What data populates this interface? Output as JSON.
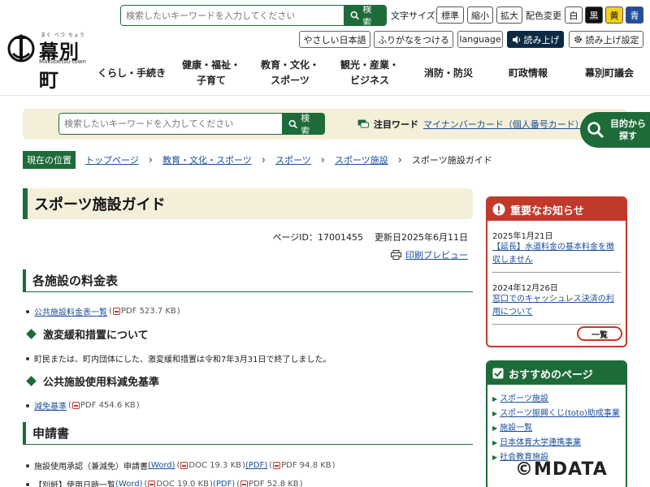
{
  "header": {
    "logo": {
      "kana": "まく べつ ちょう",
      "name": "幕別町",
      "roman": "Makubetsu-town"
    },
    "search": {
      "placeholder": "検索したいキーワードを入力してください",
      "button": "検索"
    },
    "font_size": {
      "label": "文字サイズ",
      "options": [
        "標準",
        "縮小",
        "拡大"
      ]
    },
    "color_change": {
      "label": "配色変更",
      "options": [
        "白",
        "黒",
        "黄",
        "青"
      ]
    },
    "tools": {
      "easy_japanese": "やさしい日本語",
      "furigana": "ふりがなをつける",
      "language": "language",
      "read_aloud": "読み上げ",
      "read_settings": "読み上げ設定"
    },
    "nav": [
      "くらし・手続き",
      "健康・福祉・\n子育て",
      "教育・文化・\nスポーツ",
      "観光・産業・\nビジネス",
      "消防・防災",
      "町政情報",
      "幕別町議会"
    ]
  },
  "searchbar": {
    "placeholder": "検索したいキーワードを入力してください",
    "button": "検索",
    "hot_label": "注目ワード",
    "hot_link": "マイナンバーカード（個人番号カード）",
    "purpose_button": "目的から\n探す"
  },
  "breadcrumb": {
    "here": "現在の位置",
    "links": [
      "トップページ",
      "教育・文化・スポーツ",
      "スポーツ",
      "スポーツ施設"
    ],
    "current": "スポーツ施設ガイド"
  },
  "page": {
    "title": "スポーツ施設ガイド",
    "page_id": "ページID：17001455",
    "updated": "更新日2025年6月11日",
    "print": "印刷プレビュー"
  },
  "sections": {
    "fees": {
      "heading": "各施設の料金表",
      "link": "公共施設料金表一覧",
      "file": "PDF 523.7 KB"
    },
    "relief": {
      "heading": "激変緩和措置について",
      "text": "町民または、町内団体にした、激変緩和措置は令和7年3月31日で終了しました。"
    },
    "reduction": {
      "heading": "公共施設使用料減免基準",
      "link": "減免基準",
      "file": "PDF 454.6 KB"
    },
    "application": {
      "heading": "申請書",
      "item1": {
        "text": "施設使用承認（兼減免）申請書",
        "word": "(Word)",
        "word_file": "DOC 19.3 KB",
        "pdf": "(PDF)",
        "pdf_file": "PDF 94.8 KB"
      },
      "item2": {
        "text": "【別紙】使用日時一覧",
        "word": "(Word)",
        "word_file": "DOC 19.0 KB",
        "pdf": "(PDF)",
        "pdf_file": "PDF 52.8 KB"
      }
    }
  },
  "sidebar": {
    "notice": {
      "heading": "重要なお知らせ",
      "items": [
        {
          "date": "2025年1月21日",
          "text": "【延長】水道料金の基本料金を徴収しません"
        },
        {
          "date": "2024年12月26日",
          "text": "窓口でのキャッシュレス決済の利用について"
        }
      ],
      "list_button": "一覧"
    },
    "recommend": {
      "heading": "おすすめのページ",
      "items": [
        "スポーツ施設",
        "スポーツ振興くじ(toto)助成事業",
        "施設一覧",
        "日本体育大学連携事業",
        "社会教育施設"
      ]
    }
  },
  "watermark": "©MDATA",
  "colors": {
    "primary_green": "#1e6b3a",
    "notice_red": "#c0392b",
    "link_blue": "#1a4fa0",
    "beige": "#f3efd9"
  }
}
